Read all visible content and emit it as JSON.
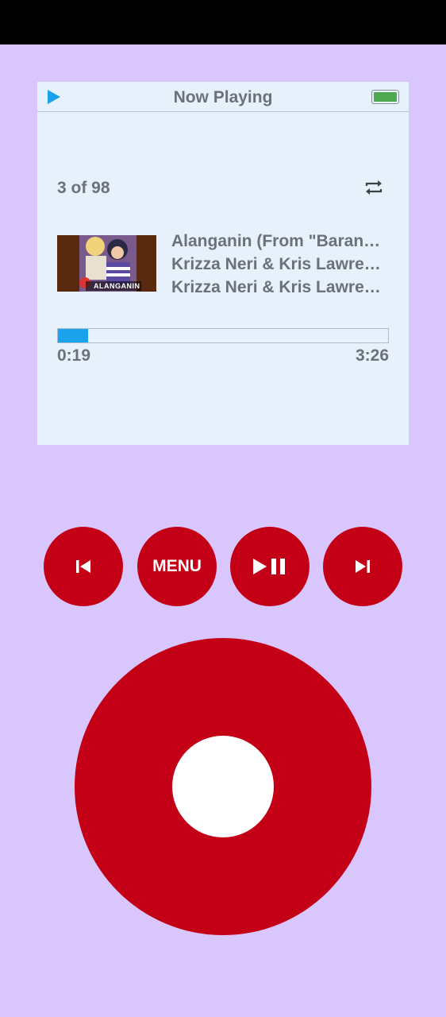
{
  "screen": {
    "header": {
      "title": "Now Playing",
      "play_icon": "play-icon",
      "battery_icon": "battery-icon",
      "battery_level": 1.0
    },
    "track_count": "3 of 98",
    "repeat_icon": "repeat-icon",
    "now_playing": {
      "artwork_caption": "ALANGANIN",
      "title": "Alanganin (From \"Baranga…",
      "artist": "Krizza Neri & Kris Lawrence",
      "album": "Krizza Neri & Kris Lawrence"
    },
    "progress": {
      "elapsed": "0:19",
      "total": "3:26",
      "fraction": 0.092
    }
  },
  "controls": {
    "previous_icon": "skip-previous-icon",
    "menu_label": "MENU",
    "play_pause_icon": "play-pause-icon",
    "next_icon": "skip-next-icon"
  },
  "colors": {
    "background": "#d8c6fd",
    "screen": "#e6f1fc",
    "accent": "#c30016",
    "progress": "#1aa3ec",
    "battery": "#4fa84f",
    "play_icon": "#1aa3ec",
    "text": "#6b7177"
  }
}
